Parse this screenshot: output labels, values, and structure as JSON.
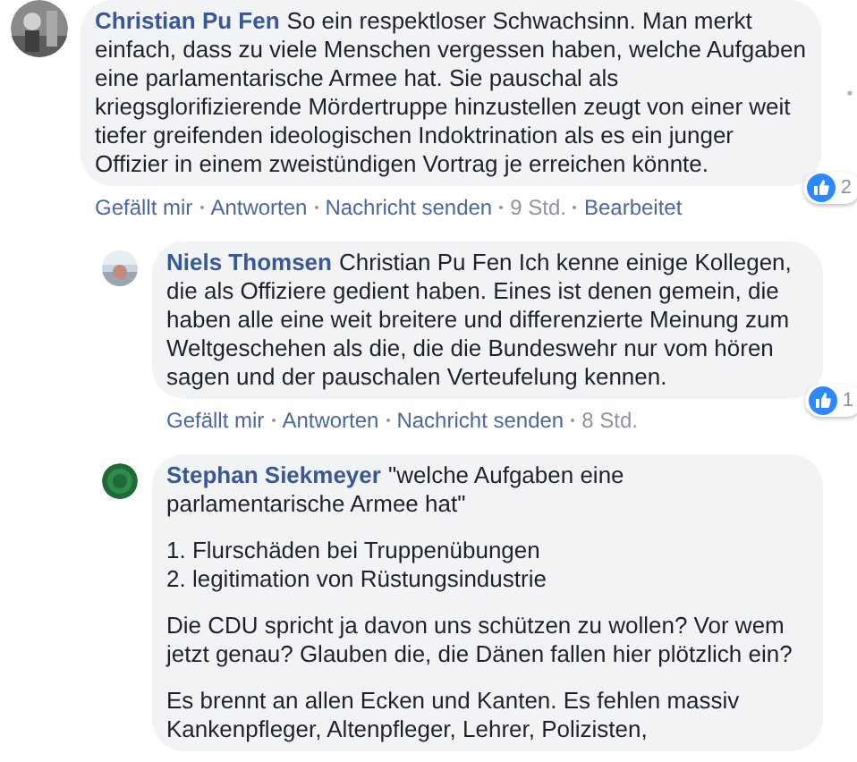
{
  "comments": [
    {
      "kind": "top",
      "author": "Christian Pu Fen",
      "paragraphs": [
        [
          "So ein respektloser Schwachsinn. Man merkt einfach, dass zu viele Menschen vergessen haben, welche Aufgaben eine parlamentarische Armee hat. Sie pauschal als kriegsglorifizierende Mördertruppe hinzustellen zeugt von einer weit tiefer greifenden ideologischen Indoktrination als es ein junger Offizier in einem zweistündigen Vortrag je erreichen könnte."
        ]
      ],
      "reactions": "2",
      "actions": [
        {
          "kind": "link",
          "label": "Gefällt mir"
        },
        {
          "kind": "link",
          "label": "Antworten"
        },
        {
          "kind": "link",
          "label": "Nachricht senden"
        },
        {
          "kind": "time",
          "label": "9 Std."
        },
        {
          "kind": "link",
          "label": "Bearbeitet"
        }
      ],
      "more_menu": true
    },
    {
      "kind": "reply",
      "author": "Niels Thomsen",
      "paragraphs": [
        [
          "Christian Pu Fen Ich kenne einige Kollegen, die als Offiziere gedient haben. Eines ist denen gemein, die haben alle eine weit breitere und differenzierte Meinung zum Weltgeschehen als die, die die Bundeswehr nur vom hören sagen und der pauschalen Verteufelung kennen."
        ]
      ],
      "reactions": "1",
      "actions": [
        {
          "kind": "link",
          "label": "Gefällt mir"
        },
        {
          "kind": "link",
          "label": "Antworten"
        },
        {
          "kind": "link",
          "label": "Nachricht senden"
        },
        {
          "kind": "time",
          "label": "8 Std."
        }
      ]
    },
    {
      "kind": "reply",
      "author": "Stephan Siekmeyer",
      "paragraphs": [
        [
          "\"welche Aufgaben eine parlamentarische Armee hat\""
        ],
        [
          "1. Flurschäden bei Truppenübungen",
          "2. legitimation von Rüstungsindustrie"
        ],
        [
          "Die CDU spricht ja davon uns schützen zu wollen? Vor wem jetzt genau? Glauben die, die Dänen fallen hier plötzlich ein?"
        ],
        [
          "Es brennt an allen Ecken und Kanten. Es fehlen massiv",
          "Kankenpfleger, Altenpfleger, Lehrer, Polizisten,"
        ]
      ]
    }
  ]
}
